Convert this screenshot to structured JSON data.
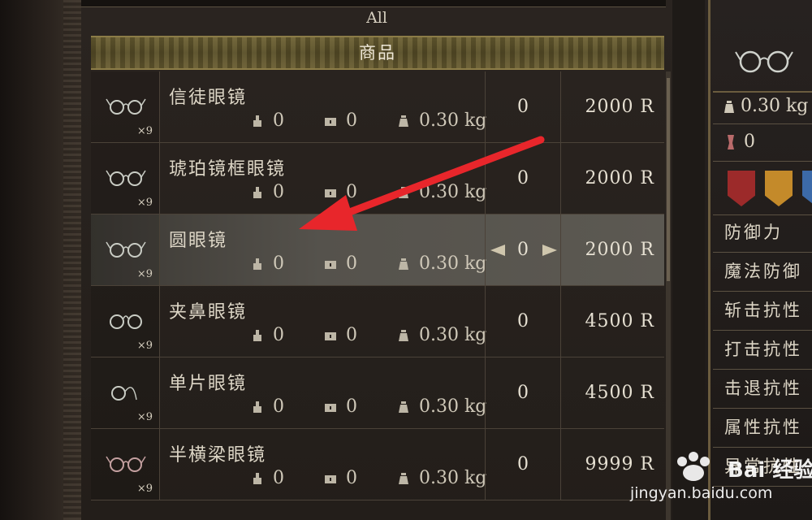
{
  "filter_tab": "All",
  "section_title": "商品",
  "items": [
    {
      "name": "信徒眼镜",
      "qty": "×9",
      "stat_a": "0",
      "stat_b": "0",
      "weight": "0.30 kg",
      "count": "0",
      "price": "2000 R",
      "selected": false
    },
    {
      "name": "琥珀镜框眼镜",
      "qty": "×9",
      "stat_a": "0",
      "stat_b": "0",
      "weight": "0.30 kg",
      "count": "0",
      "price": "2000 R",
      "selected": false
    },
    {
      "name": "圆眼镜",
      "qty": "×9",
      "stat_a": "0",
      "stat_b": "0",
      "weight": "0.30 kg",
      "count": "0",
      "price": "2000 R",
      "selected": true
    },
    {
      "name": "夹鼻眼镜",
      "qty": "×9",
      "stat_a": "0",
      "stat_b": "0",
      "weight": "0.30 kg",
      "count": "0",
      "price": "4500 R",
      "selected": false
    },
    {
      "name": "单片眼镜",
      "qty": "×9",
      "stat_a": "0",
      "stat_b": "0",
      "weight": "0.30 kg",
      "count": "0",
      "price": "4500 R",
      "selected": false
    },
    {
      "name": "半横梁眼镜",
      "qty": "×9",
      "stat_a": "0",
      "stat_b": "0",
      "weight": "0.30 kg",
      "count": "0",
      "price": "9999 R",
      "selected": false
    }
  ],
  "detail": {
    "weight": "0.30 kg",
    "durability": "0",
    "stats": [
      "防御力",
      "魔法防御",
      "斩击抗性",
      "打击抗性",
      "击退抗性",
      "属性抗性",
      "异常抗性"
    ]
  },
  "colors": {
    "header_band": "#6e6234",
    "selected_row": "#55524c",
    "annotation_arrow": "#e8262b",
    "shield_red": "#9c2a2a",
    "shield_gold": "#c48a2a",
    "shield_blue": "#3c6aa8"
  },
  "watermark": {
    "brand": "Bai 经验",
    "url": "jingyan.baidu.com"
  },
  "icons": [
    "glasses-icon",
    "hand-icon",
    "chest-icon",
    "weight-icon",
    "arrow-left-icon",
    "arrow-right-icon",
    "shield-icon",
    "paw-icon"
  ]
}
